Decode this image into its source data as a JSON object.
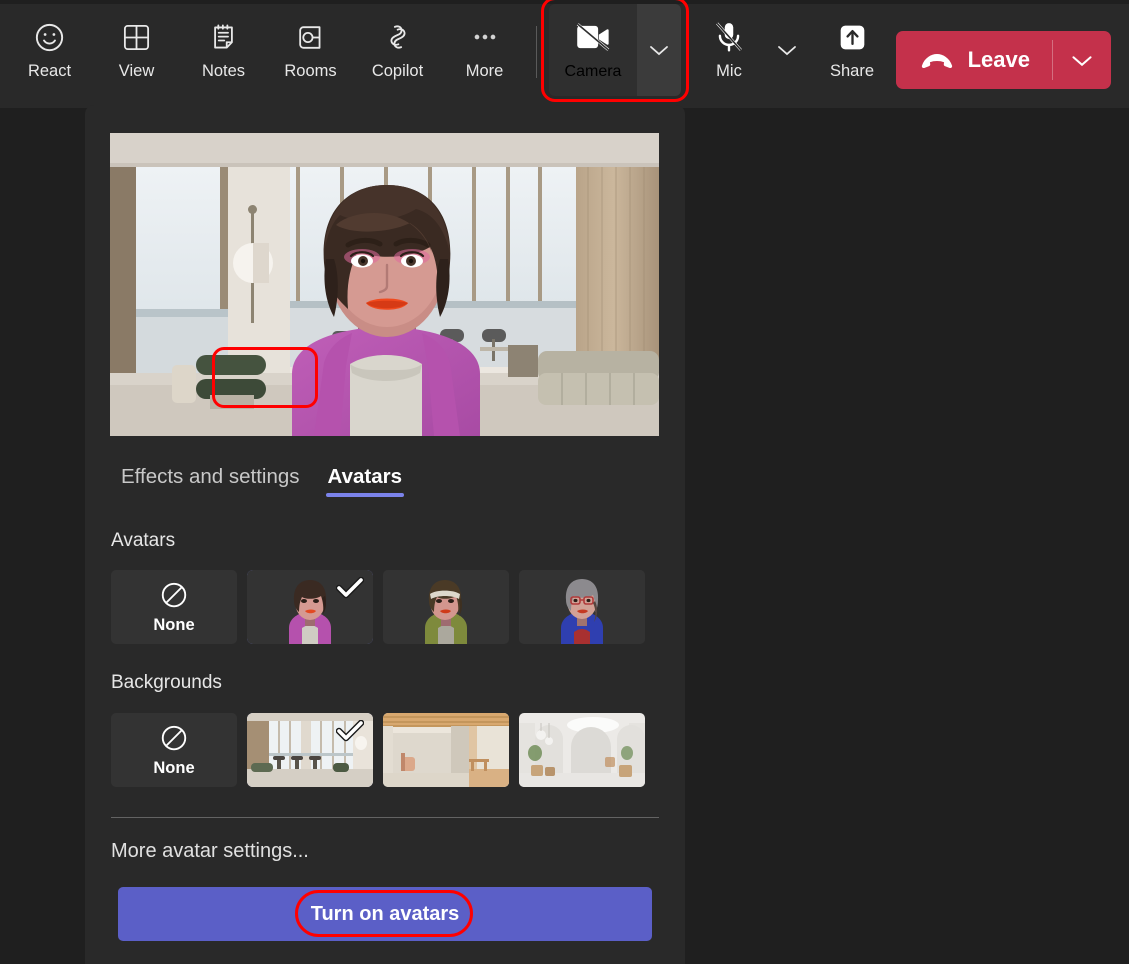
{
  "toolbar": {
    "buttons": [
      {
        "label": "React",
        "icon": "smiley-icon"
      },
      {
        "label": "View",
        "icon": "grid-icon"
      },
      {
        "label": "Notes",
        "icon": "notes-icon"
      },
      {
        "label": "Rooms",
        "icon": "rooms-icon"
      },
      {
        "label": "Copilot",
        "icon": "copilot-icon"
      },
      {
        "label": "More",
        "icon": "ellipsis-icon"
      }
    ],
    "camera": {
      "label": "Camera",
      "icon": "camera-off-icon",
      "state": "off",
      "highlighted": true
    },
    "mic": {
      "label": "Mic",
      "icon": "mic-off-icon",
      "state": "muted"
    },
    "share": {
      "label": "Share",
      "icon": "share-arrow-up-icon"
    },
    "leave": {
      "label": "Leave",
      "icon": "hangup-phone-icon",
      "color": "#c4314b"
    }
  },
  "panel": {
    "preview_alt": "Avatar preview in modern apartment background",
    "tabs": [
      {
        "label": "Effects and settings",
        "active": false
      },
      {
        "label": "Avatars",
        "active": true,
        "highlighted": true
      }
    ],
    "avatars_section": {
      "title": "Avatars",
      "none_label": "None",
      "items": [
        {
          "name": "none",
          "label": "None",
          "selected": false
        },
        {
          "name": "avatar-purple-cardigan",
          "selected": true
        },
        {
          "name": "avatar-olive-headband",
          "selected": false
        },
        {
          "name": "avatar-blue-glasses",
          "selected": false
        }
      ]
    },
    "backgrounds_section": {
      "title": "Backgrounds",
      "none_label": "None",
      "items": [
        {
          "name": "none",
          "label": "None",
          "selected": false
        },
        {
          "name": "background-apartment-windows",
          "selected": true
        },
        {
          "name": "background-wood-beams",
          "selected": false
        },
        {
          "name": "background-white-gallery",
          "selected": false
        }
      ]
    },
    "more_settings_label": "More avatar settings...",
    "turn_on_label": "Turn on avatars"
  },
  "colors": {
    "accent": "#5b5fc7",
    "selection_border": "#7b83eb",
    "leave_red": "#c4314b",
    "highlight_red": "#ff0000",
    "panel_bg": "#292929",
    "page_bg": "#1f1f1f"
  }
}
